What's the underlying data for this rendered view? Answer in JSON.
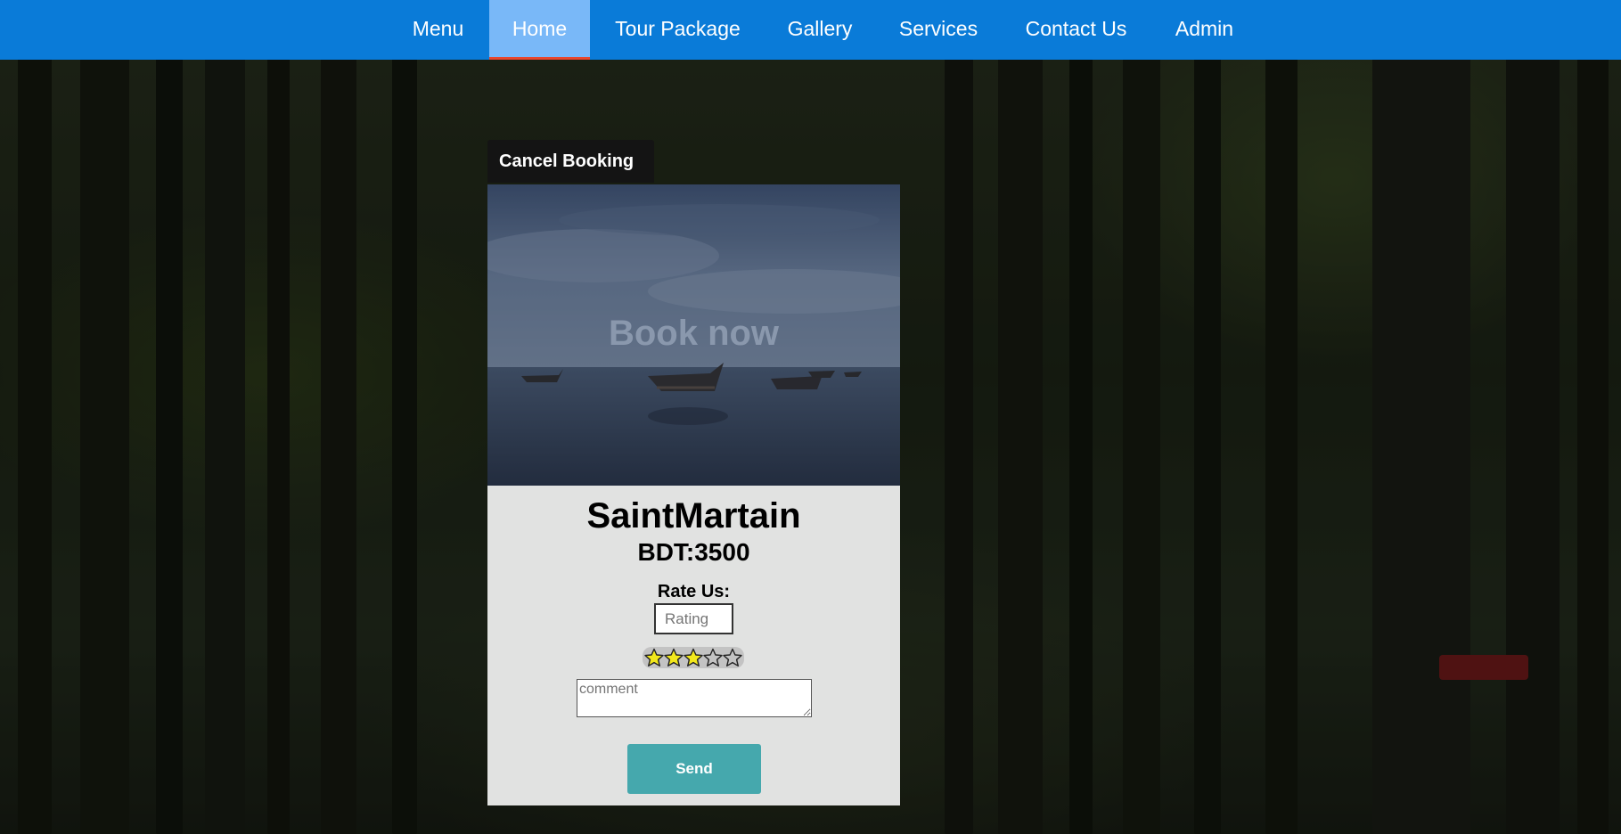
{
  "nav": {
    "items": [
      {
        "label": "Menu"
      },
      {
        "label": "Home"
      },
      {
        "label": "Tour Package"
      },
      {
        "label": "Gallery"
      },
      {
        "label": "Services"
      },
      {
        "label": "Contact Us"
      },
      {
        "label": "Admin"
      }
    ],
    "active_item": "Home",
    "bar_color": "#0a7bd8",
    "active_color": "#79b8f8",
    "active_underline_color": "#e8462c"
  },
  "booking": {
    "cancel_label": "Cancel Booking",
    "image_overlay_label": "Book now",
    "place_name": "SaintMartain",
    "price": "BDT:3500",
    "rate_label": "Rate Us:",
    "rating_placeholder": "Rating",
    "stars_total": 5,
    "stars_filled": 3,
    "comment_placeholder": "comment",
    "send_label": "Send",
    "send_color": "#45a8ad"
  }
}
